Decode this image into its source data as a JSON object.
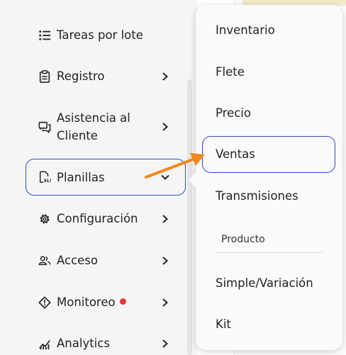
{
  "sidebar": {
    "items": [
      {
        "label": "Tareas por lote",
        "icon": "list-icon",
        "has_chevron": false
      },
      {
        "label": "Registro",
        "icon": "clipboard-icon",
        "has_chevron": true
      },
      {
        "label": "Asistencia al Cliente",
        "icon": "chat-icon",
        "has_chevron": true
      },
      {
        "label": "Planillas",
        "icon": "xls-file-icon",
        "has_chevron": true,
        "expanded": true
      },
      {
        "label": "Configuración",
        "icon": "gear-icon",
        "has_chevron": true
      },
      {
        "label": "Acceso",
        "icon": "users-icon",
        "has_chevron": true
      },
      {
        "label": "Monitoreo",
        "icon": "alert-diamond-icon",
        "has_chevron": true,
        "badge_color": "#e53935"
      },
      {
        "label": "Analytics",
        "icon": "chart-icon",
        "has_chevron": true
      }
    ]
  },
  "dropdown": {
    "items": [
      "Inventario",
      "Flete",
      "Precio",
      "Ventas",
      "Transmisiones"
    ],
    "section_label": "Producto",
    "section_items": [
      "Simple/Variación",
      "Kit"
    ]
  },
  "colors": {
    "highlight": "#3349c9",
    "arrow": "#f08a1c",
    "badge": "#e53935"
  }
}
